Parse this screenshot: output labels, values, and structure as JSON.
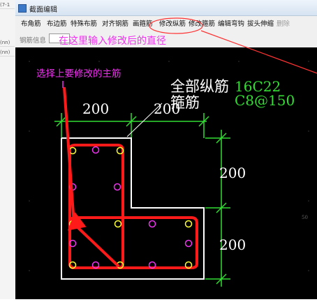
{
  "window": {
    "title": "截面编辑"
  },
  "toolbar": {
    "buttons": [
      {
        "label": "布角筋"
      },
      {
        "label": "布边筋"
      },
      {
        "label": "特殊布筋"
      },
      {
        "label": "对齐钢筋"
      },
      {
        "label": "画箍筋"
      },
      {
        "label": "修改纵筋"
      },
      {
        "label": "修改箍筋"
      },
      {
        "label": "编辑弯钩"
      },
      {
        "label": "拔头伸缩"
      },
      {
        "label": "删除"
      }
    ]
  },
  "rebar_info": {
    "label": "钢筋信息",
    "value": ""
  },
  "left_strip": {
    "cells": [
      "(7-1",
      "(nn)",
      "(nn)"
    ]
  },
  "annotations": {
    "input_hint": "在这里输入修改后的直径",
    "select_hint": "选择上要修改的主筋"
  },
  "drawing": {
    "longitudinal_label": "全部纵筋",
    "longitudinal_value": "16C22",
    "stirrup_label": "箍筋",
    "stirrup_value": "C8@150",
    "dims": {
      "top_left": "200",
      "top_right": "200",
      "right_upper": "200",
      "right_lower": "200"
    },
    "coord_marker": "50"
  },
  "colors": {
    "canvas_bg": "#000000",
    "dimension": "#33dd33",
    "stirrup": "#ff1a1a",
    "section_outline": "#ffffff",
    "bar_main": "#ffff33",
    "bar_side": "#ee33ee",
    "hint": "#ee33ee"
  }
}
